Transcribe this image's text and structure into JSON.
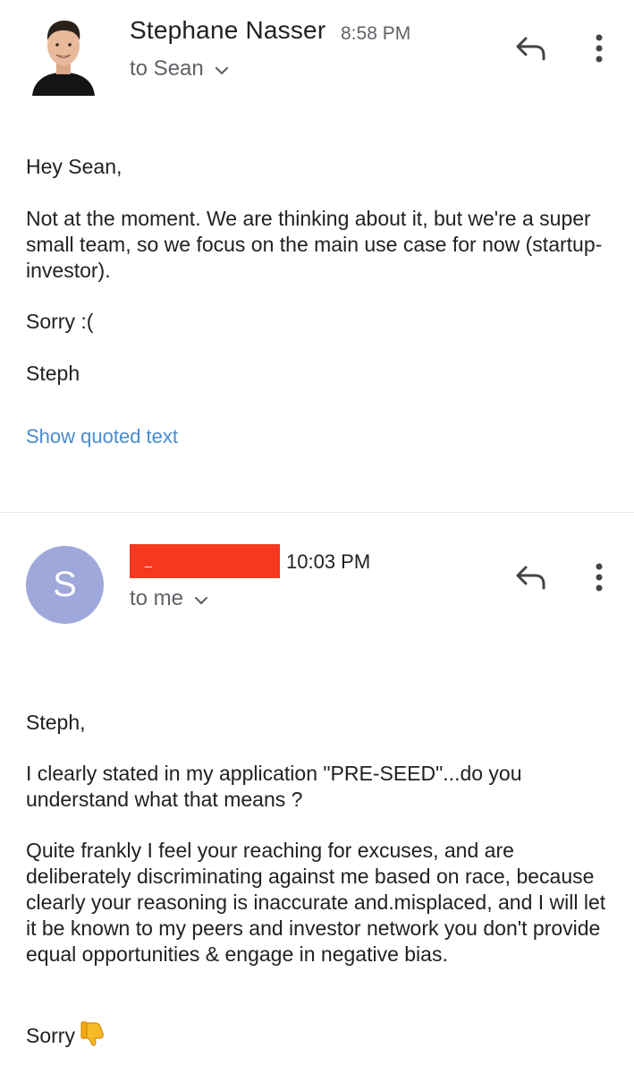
{
  "message1": {
    "sender": "Stephane Nasser",
    "time": "8:58 PM",
    "to_label": "to Sean",
    "body": {
      "greeting": "Hey Sean,",
      "paragraph": "Not at the moment. We are thinking about it, but we're a super small team, so we focus on the main use case for now (startup-investor).",
      "line3": "Sorry :(",
      "signoff": "Steph"
    },
    "show_quoted": "Show quoted text"
  },
  "message2": {
    "sender_redacted_char": "_",
    "avatar_letter": "S",
    "time": "10:03 PM",
    "to_label": "to me",
    "body": {
      "greeting": "Steph,",
      "paragraph1": "I clearly stated in my application \"PRE-SEED\"...do you understand what that means ?",
      "paragraph2": "Quite frankly I feel your reaching for excuses, and are deliberately discriminating against me based on race, because clearly your reasoning is inaccurate and.misplaced, and I will let it be  known to my peers and investor network you don't provide equal opportunities & engage in negative bias.",
      "closing": "Sorry"
    }
  },
  "colors": {
    "link": "#4a8bcf",
    "avatar_bg": "#9fa8da",
    "redaction": "#f5381f"
  },
  "icons": [
    "reply-icon",
    "more-vert-icon",
    "chevron-down-icon",
    "thumbs-down-icon"
  ]
}
